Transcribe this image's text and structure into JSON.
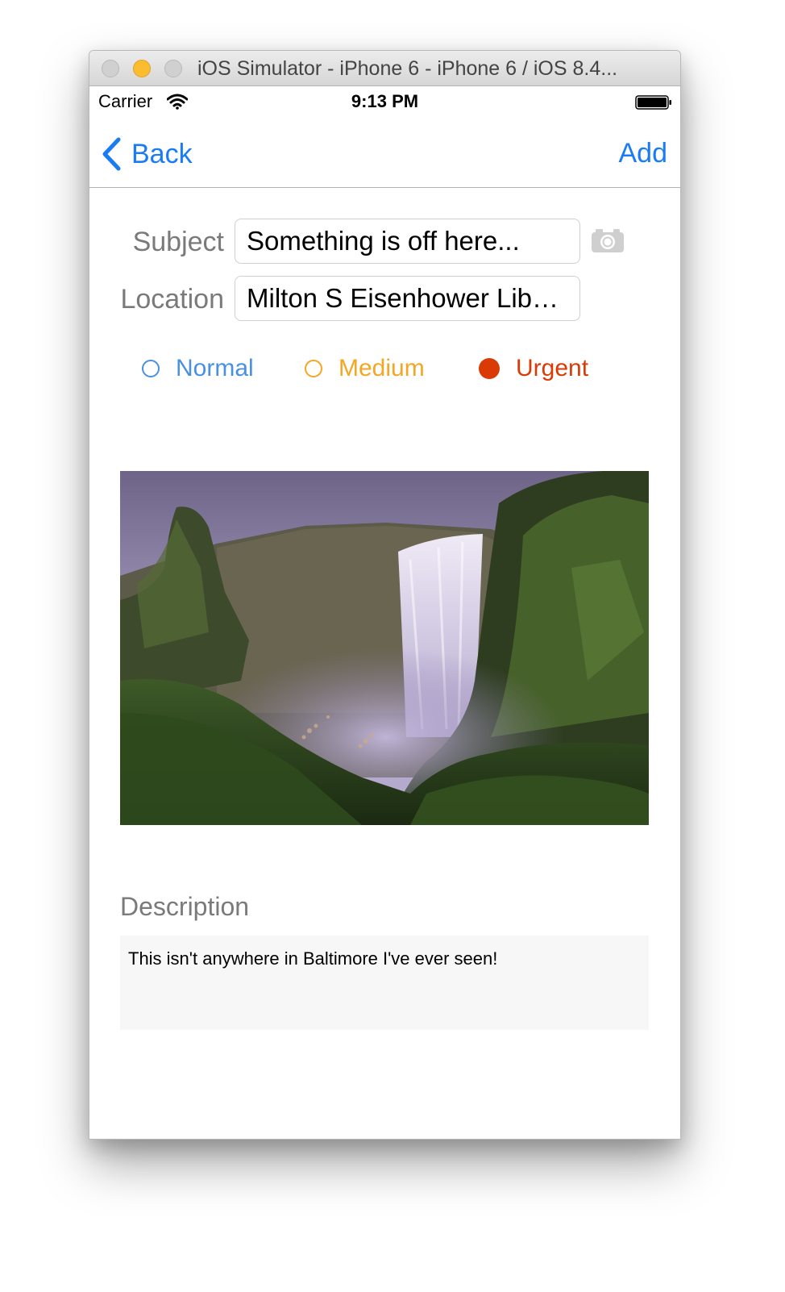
{
  "window": {
    "title": "iOS Simulator - iPhone 6 - iPhone 6 / iOS 8.4..."
  },
  "status_bar": {
    "carrier": "Carrier",
    "time": "9:13 PM",
    "icons": [
      "wifi-icon",
      "battery-icon"
    ]
  },
  "nav": {
    "back_label": "Back",
    "add_label": "Add",
    "accent_color": "#1a7cf4"
  },
  "form": {
    "subject_label": "Subject",
    "subject_value": "Something is off here...",
    "location_label": "Location",
    "location_value": "Milton S Eisenhower Lib…",
    "camera_icon": "camera-icon"
  },
  "priority": {
    "options": [
      {
        "label": "Normal",
        "color": "#4a90e2",
        "selected": false
      },
      {
        "label": "Medium",
        "color": "#f5a623",
        "selected": false
      },
      {
        "label": "Urgent",
        "color": "#d93a06",
        "selected": true
      }
    ]
  },
  "description": {
    "label": "Description",
    "value": "This isn't anywhere in Baltimore I've ever seen!"
  }
}
